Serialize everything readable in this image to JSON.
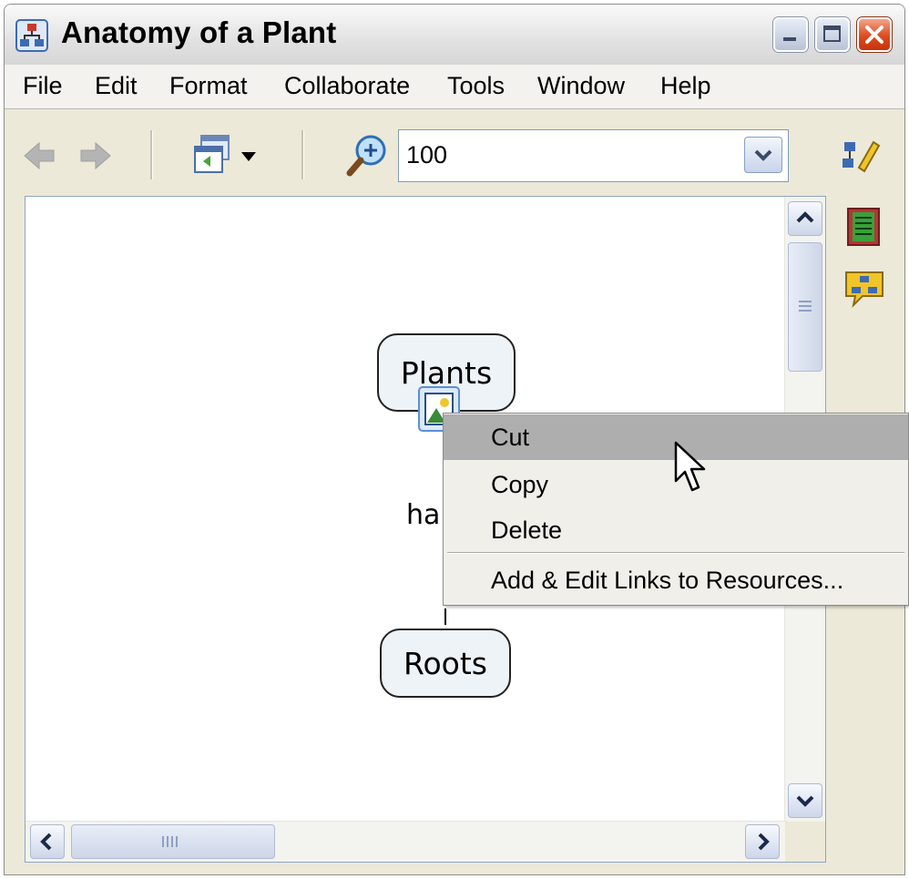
{
  "window": {
    "title": "Anatomy of a Plant",
    "icons": {
      "app": "concept-map-icon",
      "minimize": "minimize-icon",
      "maximize": "maximize-icon",
      "close": "close-icon"
    }
  },
  "menubar": {
    "items": [
      "File",
      "Edit",
      "Format",
      "Collaborate",
      "Tools",
      "Window",
      "Help"
    ]
  },
  "toolbar": {
    "icons": [
      "back-arrow-icon",
      "forward-arrow-icon",
      "view-window-icon",
      "dropdown-arrow-icon",
      "zoom-in-icon",
      "chevron-down-icon"
    ],
    "zoom_value": "100"
  },
  "side_panel": {
    "icons": [
      "style-palette-icon",
      "document-list-icon",
      "concept-map-chat-icon"
    ]
  },
  "map": {
    "concepts": [
      "Plants",
      "Roots"
    ],
    "link_label": "ha",
    "resource_icon": "image-resource-icon"
  },
  "context_menu": {
    "items": [
      "Cut",
      "Copy",
      "Delete",
      "Add & Edit Links to Resources..."
    ],
    "highlighted": "Cut"
  },
  "scrollbars": {
    "icons": [
      "scroll-up-icon",
      "scroll-down-icon",
      "scroll-left-icon",
      "scroll-right-icon"
    ]
  },
  "cursor": "mouse-pointer-icon"
}
